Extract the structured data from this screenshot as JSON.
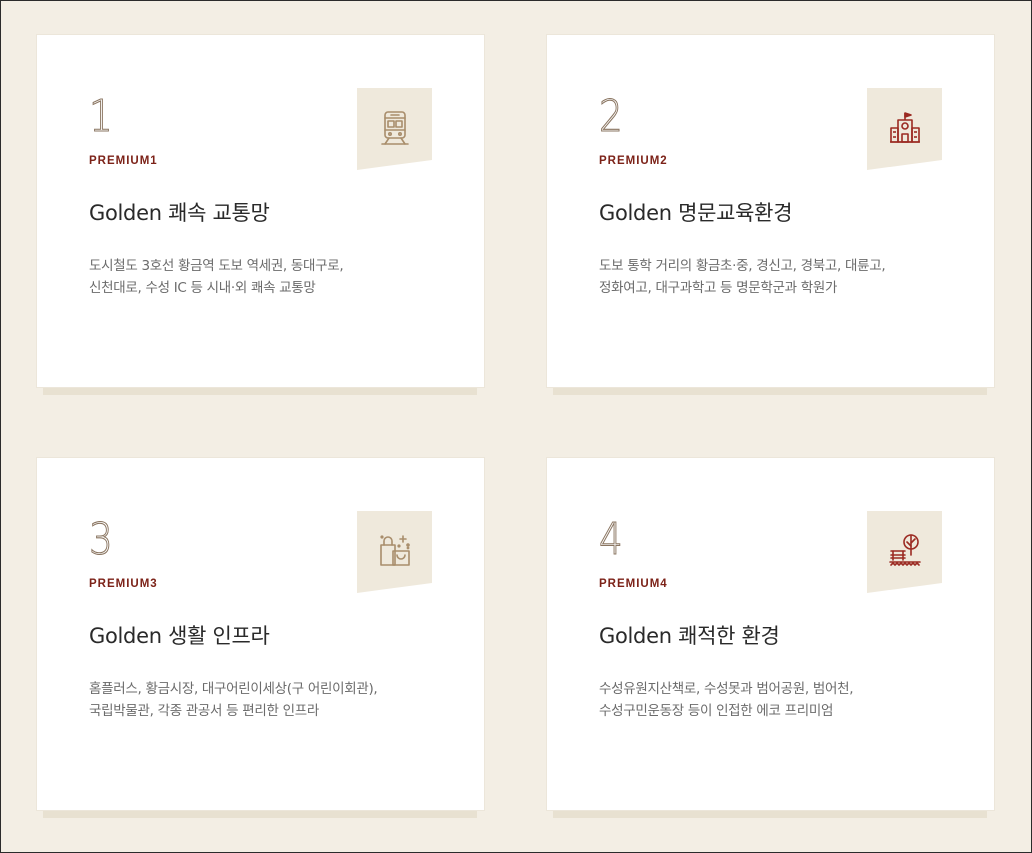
{
  "cards": [
    {
      "number": "1",
      "tag": "PREMIUM1",
      "title": "Golden 쾌속 교통망",
      "desc_line1": "도시철도 3호선 황금역 도보 역세권, 동대구로,",
      "desc_line2": "신천대로, 수성 IC 등 시내·외 쾌속 교통망",
      "icon": "train-icon"
    },
    {
      "number": "2",
      "tag": "PREMIUM2",
      "title": "Golden 명문교육환경",
      "desc_line1": "도보 통학 거리의 황금초·중, 경신고, 경북고, 대륜고,",
      "desc_line2": "정화여고, 대구과학고 등 명문학군과 학원가",
      "icon": "school-icon"
    },
    {
      "number": "3",
      "tag": "PREMIUM3",
      "title": "Golden 생활 인프라",
      "desc_line1": "홈플러스, 황금시장, 대구어린이세상(구 어린이회관),",
      "desc_line2": "국립박물관, 각종 관공서 등 편리한 인프라",
      "icon": "shopping-bag-icon"
    },
    {
      "number": "4",
      "tag": "PREMIUM4",
      "title": "Golden 쾌적한 환경",
      "desc_line1": "수성유원지산책로, 수성못과 범어공원, 범어천,",
      "desc_line2": "수성구민운동장 등이 인접한 에코 프리미엄",
      "icon": "park-bench-icon"
    }
  ],
  "colors": {
    "background": "#f3eee4",
    "card": "#ffffff",
    "accent": "#7c2218",
    "number": "#8a7561",
    "icon_bg": "#efe9dc",
    "icon_tan": "#a88d6b",
    "icon_red": "#9b2a22"
  }
}
